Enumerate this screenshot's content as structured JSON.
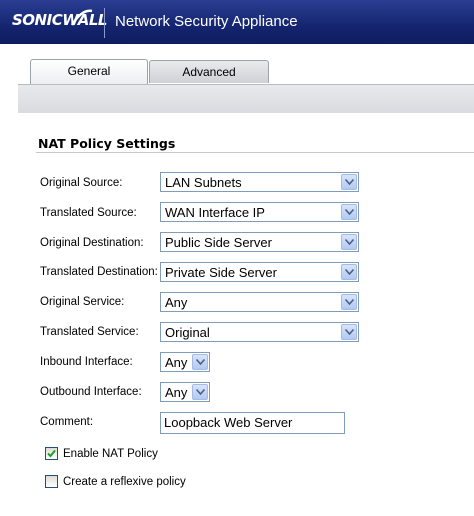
{
  "header": {
    "logo_text": "SONICWALL",
    "title": "Network Security Appliance"
  },
  "tabs": [
    {
      "label": "General",
      "active": true
    },
    {
      "label": "Advanced",
      "active": false
    }
  ],
  "section": {
    "title": "NAT Policy Settings"
  },
  "fields": {
    "original_source": {
      "label": "Original Source:",
      "value": "LAN Subnets"
    },
    "translated_source": {
      "label": "Translated Source:",
      "value": "WAN Interface IP"
    },
    "original_destination": {
      "label": "Original Destination:",
      "value": "Public Side Server"
    },
    "translated_destination": {
      "label": "Translated Destination:",
      "value": "Private Side Server"
    },
    "original_service": {
      "label": "Original Service:",
      "value": "Any"
    },
    "translated_service": {
      "label": "Translated Service:",
      "value": "Original"
    },
    "inbound_interface": {
      "label": "Inbound Interface:",
      "value": "Any"
    },
    "outbound_interface": {
      "label": "Outbound Interface:",
      "value": "Any"
    },
    "comment": {
      "label": "Comment:",
      "value": "Loopback Web Server"
    }
  },
  "checkboxes": {
    "enable_nat_policy": {
      "label": "Enable NAT Policy",
      "checked": true
    },
    "create_reflexive_policy": {
      "label": "Create a reflexive policy",
      "checked": false
    }
  },
  "colors": {
    "header_bg": "#14246f",
    "accent_check": "#21a121"
  }
}
